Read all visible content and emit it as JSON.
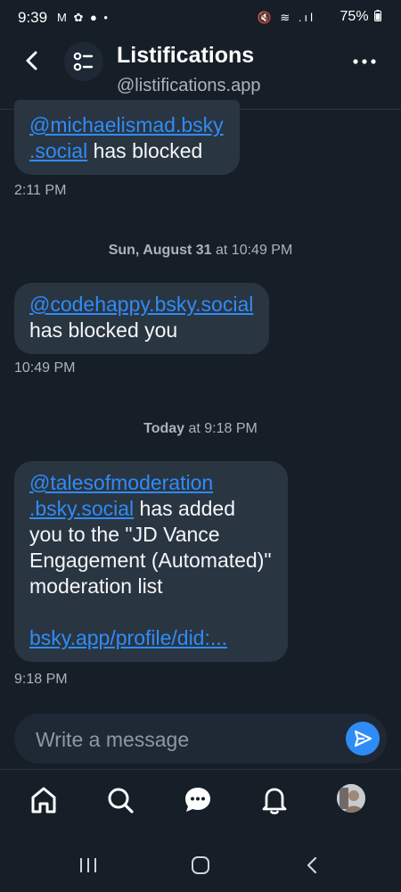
{
  "status_bar": {
    "time": "9:39",
    "left_icons": "M ✿ ● •",
    "right_icons": "🔇 ≋ .ıl",
    "battery": "75%"
  },
  "header": {
    "title": "Listifications",
    "handle": "@listifications.app"
  },
  "messages": [
    {
      "link_lines": [
        "@michaelismad.bsky",
        ".social"
      ],
      "text_after_link": " has blocked",
      "time": "2:11 PM"
    },
    {
      "day_label": "Sun, August 31",
      "day_time": " at 10:49 PM",
      "link": "@codehappy.bsky.social",
      "text": "has blocked you",
      "time": "10:49 PM"
    },
    {
      "day_label": "Today",
      "day_time": " at 9:18 PM",
      "link_line1": "@talesofmoderation",
      "link_line2": ".bsky.social",
      "text_after_link": " has added",
      "text_lines": [
        "you to the \"JD Vance",
        "Engagement (Automated)\"",
        "moderation list"
      ],
      "url": "bsky.app/profile/did:...",
      "time": "9:18 PM"
    }
  ],
  "composer": {
    "placeholder": "Write a message"
  },
  "nav": {
    "items": [
      "home-icon",
      "search-icon",
      "messages-icon",
      "notifications-icon",
      "profile-avatar"
    ]
  },
  "colors": {
    "background": "#161e27",
    "bubble": "#2a3542",
    "accent": "#2f8cf7"
  }
}
